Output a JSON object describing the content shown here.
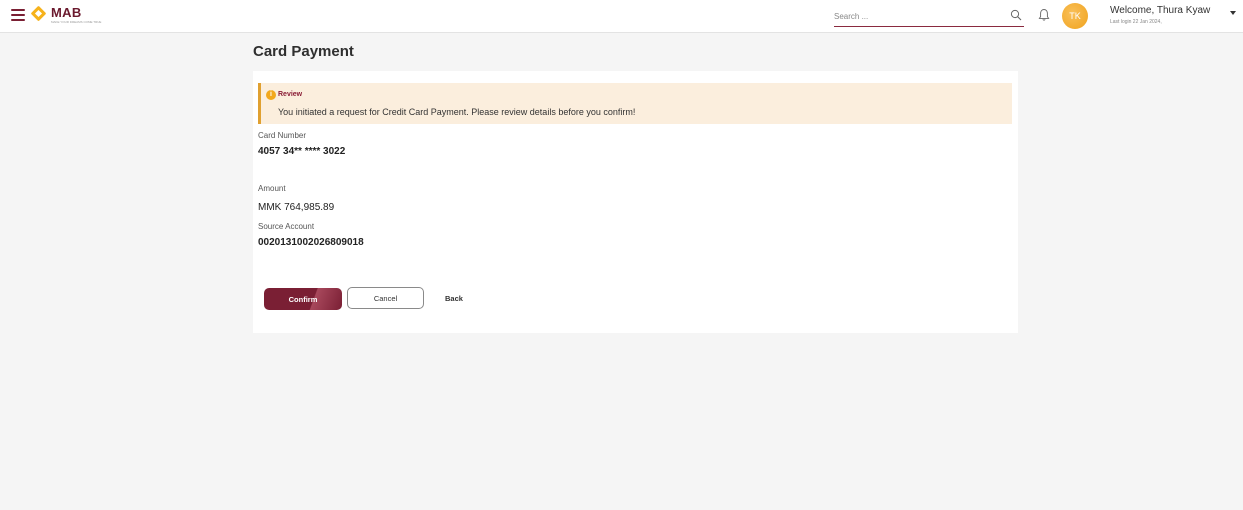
{
  "header": {
    "logo_text": "MAB",
    "logo_tagline": "MAKE YOUR DREAMS COME TRUE",
    "search_placeholder": "Search ...",
    "avatar_initials": "TK",
    "welcome_text": "Welcome, Thura Kyaw",
    "last_login": "Last login 22 Jan 2024,",
    "icons": [
      "menu-icon",
      "search-icon",
      "bell-icon",
      "chevron-down-icon"
    ],
    "brand_color": "#7a1f34",
    "accent_color": "#f2a81d"
  },
  "page": {
    "title": "Card Payment"
  },
  "review": {
    "title": "Review",
    "message": "You initiated a request for Credit Card Payment. Please review details before you confirm!"
  },
  "details": {
    "card_number_label": "Card Number",
    "card_number_value": "4057 34** **** 3022",
    "amount_label": "Amount",
    "amount_value": "MMK 764,985.89",
    "source_account_label": "Source Account",
    "source_account_value": "0020131002026809018"
  },
  "actions": {
    "confirm_label": "Confirm",
    "cancel_label": "Cancel",
    "back_label": "Back"
  }
}
